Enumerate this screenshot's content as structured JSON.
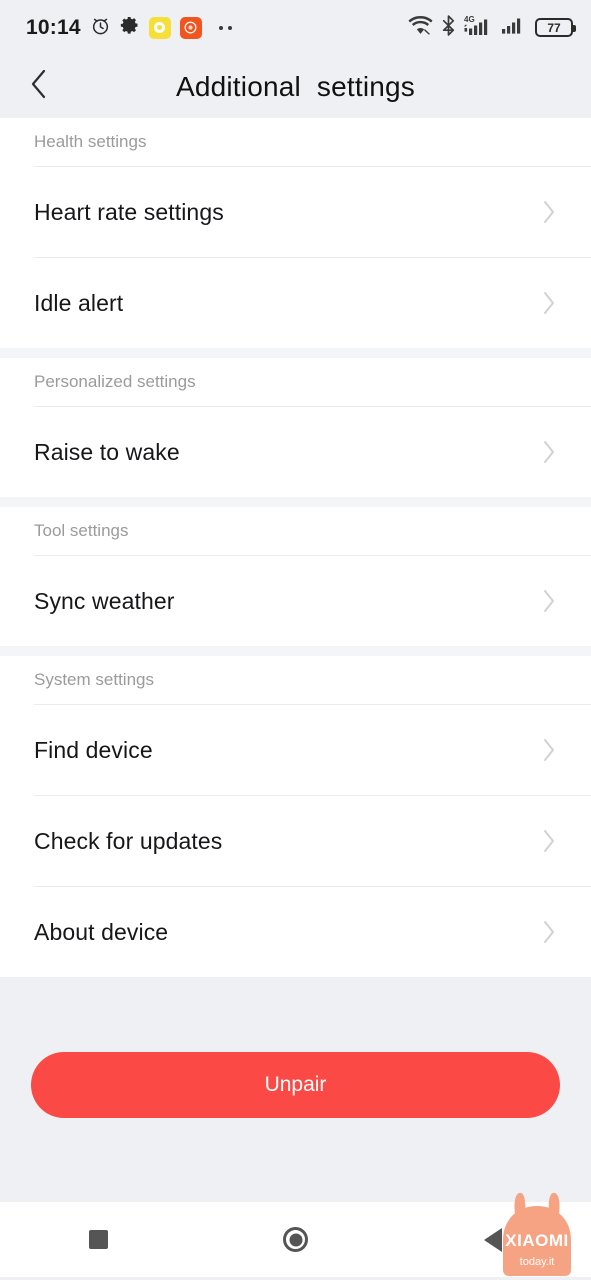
{
  "status_bar": {
    "time": "10:14",
    "icons_left": [
      "alarm-clock-icon",
      "gear-icon",
      "app-icon-yellow",
      "app-icon-orange",
      "more-notifications-dots"
    ],
    "icons_right": [
      "wifi-icon",
      "bluetooth-icon",
      "signal-4g-icon",
      "signal-icon",
      "battery-icon"
    ],
    "network_label": "4G",
    "battery_level": "77"
  },
  "header": {
    "title": "Additional  settings",
    "back_icon": "chevron-left-icon"
  },
  "sections": [
    {
      "header": "Health settings",
      "items": [
        {
          "label": "Heart rate settings",
          "chevron": "chevron-right-icon"
        },
        {
          "label": "Idle alert",
          "chevron": "chevron-right-icon"
        }
      ]
    },
    {
      "header": "Personalized settings",
      "items": [
        {
          "label": "Raise to wake",
          "chevron": "chevron-right-icon"
        }
      ]
    },
    {
      "header": "Tool settings",
      "items": [
        {
          "label": "Sync weather",
          "chevron": "chevron-right-icon"
        }
      ]
    },
    {
      "header": "System settings",
      "items": [
        {
          "label": "Find device",
          "chevron": "chevron-right-icon"
        },
        {
          "label": "Check for updates",
          "chevron": "chevron-right-icon"
        },
        {
          "label": "About device",
          "chevron": "chevron-right-icon"
        }
      ]
    }
  ],
  "footer": {
    "unpair_label": "Unpair"
  },
  "nav_bar": {
    "recents": "square-recents-icon",
    "home": "circle-home-icon",
    "back": "triangle-back-icon"
  },
  "watermark": {
    "brand": "XIAOMI",
    "site": "today.it"
  },
  "colors": {
    "accent_danger": "#FB4A45",
    "bar_background": "#eef0f3",
    "content_background": "#ffffff",
    "section_gap": "#f4f5f7",
    "divider": "#ececec",
    "section_header_text": "#9b9b9b",
    "item_text": "#17171a",
    "chevron": "#d2d2d2",
    "watermark": "#F6A383"
  }
}
